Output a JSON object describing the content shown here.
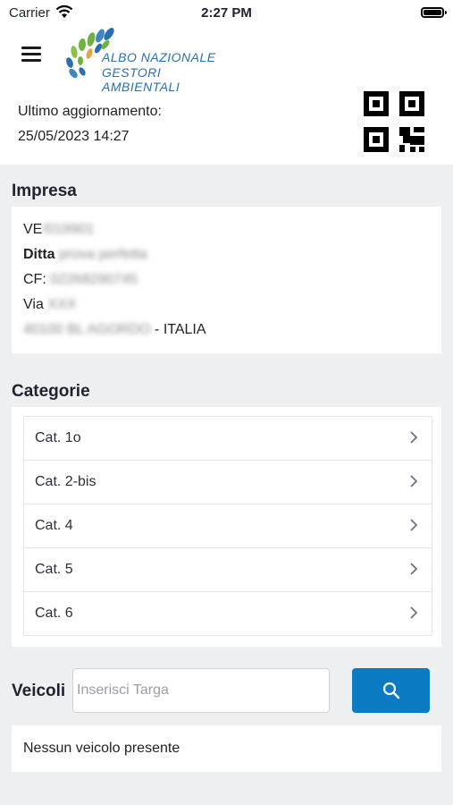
{
  "status_bar": {
    "carrier": "Carrier",
    "time": "2:27 PM"
  },
  "header": {
    "logo_line1": "ALBO NAZIONALE",
    "logo_line2": "GESTORI AMBIENTALI",
    "update_label": "Ultimo aggiornamento:",
    "update_date": "25/05/2023 14:27"
  },
  "impresa": {
    "title": "Impresa",
    "code_prefix": "VE",
    "code_value": "/019901",
    "ditta_label": "Ditta",
    "ditta_value": "prova perfetta",
    "cf_label": "CF:",
    "cf_value": "02268290745",
    "via_label": "Via",
    "via_value": "XXX",
    "city_value": "40100 BL AGORDO",
    "country": "- ITALIA"
  },
  "categorie": {
    "title": "Categorie",
    "items": [
      {
        "label": "Cat. 1o"
      },
      {
        "label": "Cat. 2-bis"
      },
      {
        "label": "Cat. 4"
      },
      {
        "label": "Cat. 5"
      },
      {
        "label": "Cat. 6"
      }
    ]
  },
  "veicoli": {
    "title": "Veicoli",
    "placeholder": "Inserisci Targa",
    "empty_text": "Nessun veicolo presente"
  },
  "colors": {
    "accent": "#0a7bc2",
    "background": "#eeeff1",
    "logo_blue": "#2a6fb0",
    "logo_green": "#6cb33f"
  }
}
